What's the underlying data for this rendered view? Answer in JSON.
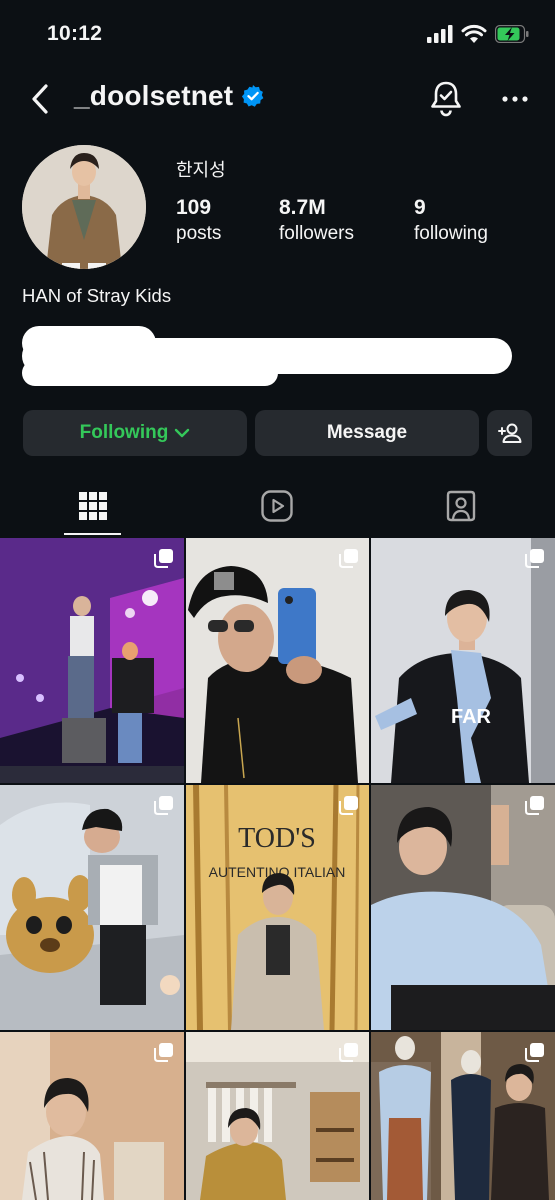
{
  "status_bar": {
    "time": "10:12",
    "icons": [
      "cellular-signal-icon",
      "wifi-icon",
      "battery-charging-icon"
    ]
  },
  "header": {
    "username": "_doolsetnet",
    "verified": true,
    "icons": [
      "back-arrow-icon",
      "verified-badge-icon",
      "notification-bell-icon",
      "more-options-icon"
    ]
  },
  "profile": {
    "display_name": "한지성",
    "stats": [
      {
        "value": "109",
        "label": "posts"
      },
      {
        "value": "8.7M",
        "label": "followers"
      },
      {
        "value": "9",
        "label": "following"
      }
    ],
    "bio": "HAN of Stray Kids"
  },
  "actions": {
    "following_label": "Following",
    "message_label": "Message"
  },
  "tabs": [
    {
      "icon": "grid-icon",
      "active": true
    },
    {
      "icon": "reels-icon",
      "active": false
    },
    {
      "icon": "tagged-icon",
      "active": false
    }
  ],
  "colors": {
    "background": "#0c1014",
    "button_bg": "#262a2f",
    "following_green": "#34c85a",
    "verified_blue": "#0095f6"
  },
  "grid_posts": [
    {
      "type": "concert",
      "multi": true
    },
    {
      "type": "mirror-selfie",
      "multi": true
    },
    {
      "type": "studio-portrait",
      "multi": true
    },
    {
      "type": "mascot-photo",
      "multi": true
    },
    {
      "type": "brand-event",
      "multi": true,
      "sign_text": "TOD'S",
      "sign_subtext": "AUTENTINO ITALIAN"
    },
    {
      "type": "sofa-portrait",
      "multi": true
    },
    {
      "type": "window-portrait",
      "multi": true
    },
    {
      "type": "boutique-photo",
      "multi": true
    },
    {
      "type": "store-mannequins",
      "multi": true
    }
  ]
}
